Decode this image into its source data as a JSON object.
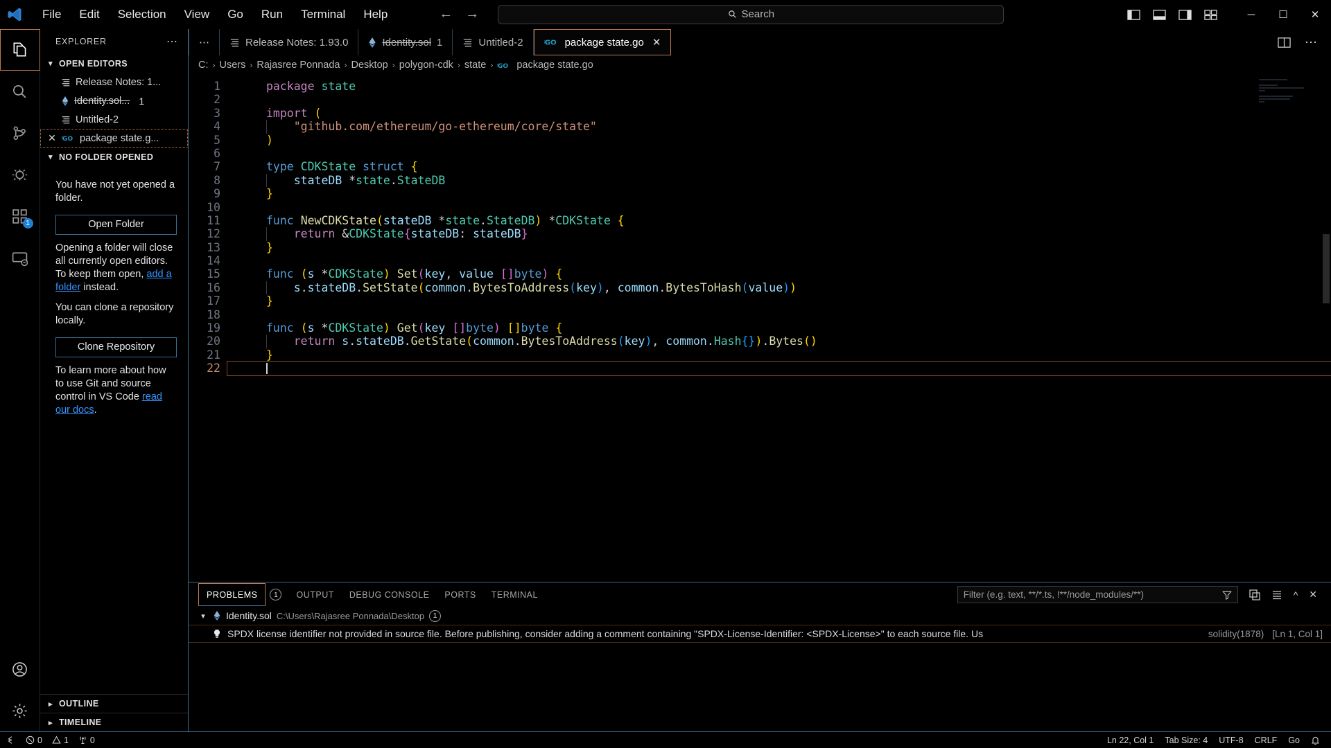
{
  "titlebar": {
    "logo_icon": "vscode-logo-icon",
    "menus": [
      "File",
      "Edit",
      "Selection",
      "View",
      "Go",
      "Run",
      "Terminal",
      "Help"
    ],
    "back_icon": "arrow-left-icon",
    "forward_icon": "arrow-right-icon",
    "search_placeholder": "Search",
    "search_icon": "search-icon",
    "layout_icons": [
      "toggle-primary-sidebar-icon",
      "toggle-panel-icon",
      "toggle-secondary-sidebar-icon",
      "customize-layout-icon"
    ],
    "window_controls": {
      "minimize": "─",
      "maximize": "☐",
      "close": "✕"
    }
  },
  "activitybar": {
    "items": [
      {
        "name": "explorer",
        "icon": "files-icon",
        "active": true,
        "badge": ""
      },
      {
        "name": "search",
        "icon": "search-icon",
        "active": false,
        "badge": ""
      },
      {
        "name": "source-control",
        "icon": "source-control-icon",
        "active": false,
        "badge": ""
      },
      {
        "name": "run-and-debug",
        "icon": "debug-icon",
        "active": false,
        "badge": ""
      },
      {
        "name": "extensions",
        "icon": "extensions-icon",
        "active": false,
        "badge": "1"
      },
      {
        "name": "remote-explorer",
        "icon": "remote-icon",
        "active": false,
        "badge": ""
      }
    ],
    "bottom": [
      {
        "name": "accounts",
        "icon": "account-icon"
      },
      {
        "name": "manage",
        "icon": "gear-icon"
      }
    ]
  },
  "sidebar": {
    "title": "EXPLORER",
    "more_actions": "⋯",
    "open_editors": {
      "label": "OPEN EDITORS",
      "items": [
        {
          "label": "Release Notes: 1...",
          "icon": "release-notes-icon",
          "badge": "",
          "selected": false,
          "strike": false
        },
        {
          "label": "Identity.sol...",
          "icon": "solidity-icon",
          "badge": "1",
          "selected": false,
          "strike": true
        },
        {
          "label": "Untitled-2",
          "icon": "file-lines-icon",
          "badge": "",
          "selected": false,
          "strike": false
        },
        {
          "label": "package state.g...",
          "icon": "go-icon",
          "badge": "",
          "selected": true,
          "strike": false,
          "close_icon": "close-icon"
        }
      ]
    },
    "no_folder": {
      "label": "NO FOLDER OPENED",
      "text1": "You have not yet opened a folder.",
      "open_folder_button": "Open Folder",
      "text2_a": "Opening a folder will close all currently open editors. To keep them open, ",
      "text2_link": "add a folder",
      "text2_b": " instead.",
      "text3": "You can clone a repository locally.",
      "clone_button": "Clone Repository",
      "text4_a": "To learn more about how to use Git and source control in VS Code ",
      "text4_link": "read our docs",
      "text4_b": "."
    },
    "outline": "OUTLINE",
    "timeline": "TIMELINE"
  },
  "tabs": {
    "more_icon": "⋯",
    "items": [
      {
        "label": "Release Notes: 1.93.0",
        "icon": "file-lines-icon",
        "active": false,
        "strike": false,
        "badge": ""
      },
      {
        "label": "Identity.sol",
        "icon": "solidity-icon",
        "active": false,
        "strike": true,
        "badge": "1"
      },
      {
        "label": "Untitled-2",
        "icon": "file-lines-icon",
        "active": false,
        "strike": false,
        "badge": ""
      },
      {
        "label": "package state.go",
        "icon": "go-icon",
        "active": true,
        "strike": false,
        "badge": "",
        "close_icon": "close-icon"
      }
    ],
    "right_actions": [
      "split-editor-icon",
      "more-actions-icon"
    ]
  },
  "breadcrumb": {
    "separator": "›",
    "items": [
      "C:",
      "Users",
      "Rajasree Ponnada",
      "Desktop",
      "polygon-cdk",
      "state",
      "package state.go"
    ],
    "last_icon": "go-icon"
  },
  "editor": {
    "language": "Go",
    "current_line": 22,
    "lines": [
      {
        "n": 1,
        "tokens": [
          {
            "t": "package",
            "c": "k-kw"
          },
          {
            "t": " ",
            "c": "k-plain"
          },
          {
            "t": "state",
            "c": "k-type"
          }
        ]
      },
      {
        "n": 2,
        "tokens": []
      },
      {
        "n": 3,
        "tokens": [
          {
            "t": "import",
            "c": "k-kw"
          },
          {
            "t": " ",
            "c": "k-plain"
          },
          {
            "t": "(",
            "c": "k-par"
          }
        ]
      },
      {
        "n": 4,
        "tokens": [
          {
            "t": "    ",
            "c": "k-plain"
          },
          {
            "t": "\"github.com/ethereum/go-ethereum/core/state\"",
            "c": "k-str"
          }
        ],
        "indent": true
      },
      {
        "n": 5,
        "tokens": [
          {
            "t": ")",
            "c": "k-par"
          }
        ]
      },
      {
        "n": 6,
        "tokens": []
      },
      {
        "n": 7,
        "tokens": [
          {
            "t": "type",
            "c": "k-kw2"
          },
          {
            "t": " ",
            "c": "k-plain"
          },
          {
            "t": "CDKState",
            "c": "k-type"
          },
          {
            "t": " ",
            "c": "k-plain"
          },
          {
            "t": "struct",
            "c": "k-kw2"
          },
          {
            "t": " ",
            "c": "k-plain"
          },
          {
            "t": "{",
            "c": "k-par"
          }
        ]
      },
      {
        "n": 8,
        "tokens": [
          {
            "t": "    ",
            "c": "k-plain"
          },
          {
            "t": "stateDB",
            "c": "k-var"
          },
          {
            "t": " *",
            "c": "k-plain"
          },
          {
            "t": "state",
            "c": "k-type"
          },
          {
            "t": ".",
            "c": "k-plain"
          },
          {
            "t": "StateDB",
            "c": "k-type"
          }
        ],
        "indent": true
      },
      {
        "n": 9,
        "tokens": [
          {
            "t": "}",
            "c": "k-par"
          }
        ]
      },
      {
        "n": 10,
        "tokens": []
      },
      {
        "n": 11,
        "tokens": [
          {
            "t": "func",
            "c": "k-kw2"
          },
          {
            "t": " ",
            "c": "k-plain"
          },
          {
            "t": "NewCDKState",
            "c": "k-fn"
          },
          {
            "t": "(",
            "c": "k-par"
          },
          {
            "t": "stateDB",
            "c": "k-var"
          },
          {
            "t": " *",
            "c": "k-plain"
          },
          {
            "t": "state",
            "c": "k-type"
          },
          {
            "t": ".",
            "c": "k-plain"
          },
          {
            "t": "StateDB",
            "c": "k-type"
          },
          {
            "t": ")",
            "c": "k-par"
          },
          {
            "t": " *",
            "c": "k-plain"
          },
          {
            "t": "CDKState",
            "c": "k-type"
          },
          {
            "t": " ",
            "c": "k-plain"
          },
          {
            "t": "{",
            "c": "k-par"
          }
        ]
      },
      {
        "n": 12,
        "tokens": [
          {
            "t": "    ",
            "c": "k-plain"
          },
          {
            "t": "return",
            "c": "k-kw"
          },
          {
            "t": " &",
            "c": "k-plain"
          },
          {
            "t": "CDKState",
            "c": "k-type"
          },
          {
            "t": "{",
            "c": "k-par2"
          },
          {
            "t": "stateDB",
            "c": "k-var"
          },
          {
            "t": ": ",
            "c": "k-plain"
          },
          {
            "t": "stateDB",
            "c": "k-var"
          },
          {
            "t": "}",
            "c": "k-par2"
          }
        ],
        "indent": true
      },
      {
        "n": 13,
        "tokens": [
          {
            "t": "}",
            "c": "k-par"
          }
        ]
      },
      {
        "n": 14,
        "tokens": []
      },
      {
        "n": 15,
        "tokens": [
          {
            "t": "func",
            "c": "k-kw2"
          },
          {
            "t": " ",
            "c": "k-plain"
          },
          {
            "t": "(",
            "c": "k-par"
          },
          {
            "t": "s",
            "c": "k-var"
          },
          {
            "t": " *",
            "c": "k-plain"
          },
          {
            "t": "CDKState",
            "c": "k-type"
          },
          {
            "t": ")",
            "c": "k-par"
          },
          {
            "t": " ",
            "c": "k-plain"
          },
          {
            "t": "Set",
            "c": "k-fn"
          },
          {
            "t": "(",
            "c": "k-par2"
          },
          {
            "t": "key",
            "c": "k-var"
          },
          {
            "t": ", ",
            "c": "k-plain"
          },
          {
            "t": "value",
            "c": "k-var"
          },
          {
            "t": " ",
            "c": "k-plain"
          },
          {
            "t": "[]",
            "c": "k-par2"
          },
          {
            "t": "byte",
            "c": "k-kw2"
          },
          {
            "t": ")",
            "c": "k-par2"
          },
          {
            "t": " ",
            "c": "k-plain"
          },
          {
            "t": "{",
            "c": "k-par"
          }
        ]
      },
      {
        "n": 16,
        "tokens": [
          {
            "t": "    ",
            "c": "k-plain"
          },
          {
            "t": "s",
            "c": "k-var"
          },
          {
            "t": ".",
            "c": "k-plain"
          },
          {
            "t": "stateDB",
            "c": "k-var"
          },
          {
            "t": ".",
            "c": "k-plain"
          },
          {
            "t": "SetState",
            "c": "k-fn"
          },
          {
            "t": "(",
            "c": "k-par"
          },
          {
            "t": "common",
            "c": "k-var"
          },
          {
            "t": ".",
            "c": "k-plain"
          },
          {
            "t": "BytesToAddress",
            "c": "k-fn"
          },
          {
            "t": "(",
            "c": "k-par3"
          },
          {
            "t": "key",
            "c": "k-var"
          },
          {
            "t": ")",
            "c": "k-par3"
          },
          {
            "t": ", ",
            "c": "k-plain"
          },
          {
            "t": "common",
            "c": "k-var"
          },
          {
            "t": ".",
            "c": "k-plain"
          },
          {
            "t": "BytesToHash",
            "c": "k-fn"
          },
          {
            "t": "(",
            "c": "k-par3"
          },
          {
            "t": "value",
            "c": "k-var"
          },
          {
            "t": ")",
            "c": "k-par3"
          },
          {
            "t": ")",
            "c": "k-par"
          }
        ],
        "indent": true
      },
      {
        "n": 17,
        "tokens": [
          {
            "t": "}",
            "c": "k-par"
          }
        ]
      },
      {
        "n": 18,
        "tokens": []
      },
      {
        "n": 19,
        "tokens": [
          {
            "t": "func",
            "c": "k-kw2"
          },
          {
            "t": " ",
            "c": "k-plain"
          },
          {
            "t": "(",
            "c": "k-par"
          },
          {
            "t": "s",
            "c": "k-var"
          },
          {
            "t": " *",
            "c": "k-plain"
          },
          {
            "t": "CDKState",
            "c": "k-type"
          },
          {
            "t": ")",
            "c": "k-par"
          },
          {
            "t": " ",
            "c": "k-plain"
          },
          {
            "t": "Get",
            "c": "k-fn"
          },
          {
            "t": "(",
            "c": "k-par2"
          },
          {
            "t": "key",
            "c": "k-var"
          },
          {
            "t": " ",
            "c": "k-plain"
          },
          {
            "t": "[]",
            "c": "k-par2"
          },
          {
            "t": "byte",
            "c": "k-kw2"
          },
          {
            "t": ")",
            "c": "k-par2"
          },
          {
            "t": " ",
            "c": "k-plain"
          },
          {
            "t": "[]",
            "c": "k-par"
          },
          {
            "t": "byte",
            "c": "k-kw2"
          },
          {
            "t": " ",
            "c": "k-plain"
          },
          {
            "t": "{",
            "c": "k-par"
          }
        ]
      },
      {
        "n": 20,
        "tokens": [
          {
            "t": "    ",
            "c": "k-plain"
          },
          {
            "t": "return",
            "c": "k-kw"
          },
          {
            "t": " ",
            "c": "k-plain"
          },
          {
            "t": "s",
            "c": "k-var"
          },
          {
            "t": ".",
            "c": "k-plain"
          },
          {
            "t": "stateDB",
            "c": "k-var"
          },
          {
            "t": ".",
            "c": "k-plain"
          },
          {
            "t": "GetState",
            "c": "k-fn"
          },
          {
            "t": "(",
            "c": "k-par"
          },
          {
            "t": "common",
            "c": "k-var"
          },
          {
            "t": ".",
            "c": "k-plain"
          },
          {
            "t": "BytesToAddress",
            "c": "k-fn"
          },
          {
            "t": "(",
            "c": "k-par3"
          },
          {
            "t": "key",
            "c": "k-var"
          },
          {
            "t": ")",
            "c": "k-par3"
          },
          {
            "t": ", ",
            "c": "k-plain"
          },
          {
            "t": "common",
            "c": "k-var"
          },
          {
            "t": ".",
            "c": "k-plain"
          },
          {
            "t": "Hash",
            "c": "k-type"
          },
          {
            "t": "{}",
            "c": "k-par3"
          },
          {
            "t": ")",
            "c": "k-par"
          },
          {
            "t": ".",
            "c": "k-plain"
          },
          {
            "t": "Bytes",
            "c": "k-fn"
          },
          {
            "t": "()",
            "c": "k-par"
          }
        ],
        "indent": true
      },
      {
        "n": 21,
        "tokens": [
          {
            "t": "}",
            "c": "k-par"
          }
        ]
      },
      {
        "n": 22,
        "tokens": [],
        "current": true
      }
    ]
  },
  "panel": {
    "tabs": [
      {
        "label": "PROBLEMS",
        "badge": "1",
        "active": true
      },
      {
        "label": "OUTPUT",
        "badge": "",
        "active": false
      },
      {
        "label": "DEBUG CONSOLE",
        "badge": "",
        "active": false
      },
      {
        "label": "PORTS",
        "badge": "",
        "active": false
      },
      {
        "label": "TERMINAL",
        "badge": "",
        "active": false
      }
    ],
    "filter_placeholder": "Filter (e.g. text, **/*.ts, !**/node_modules/**)",
    "filter_icon": "filter-icon",
    "actions": [
      "collapse-all-icon",
      "view-as-list-icon",
      "chevron-up-icon",
      "close-icon"
    ],
    "group": {
      "chevron": "chevron-down-icon",
      "file_icon": "solidity-icon",
      "file": "Identity.sol",
      "path": "C:\\Users\\Rajasree Ponnada\\Desktop",
      "count": "1"
    },
    "problem": {
      "icon": "lightbulb-icon",
      "message": "SPDX license identifier not provided in source file. Before publishing, consider adding a comment containing \"SPDX-License-Identifier: <SPDX-License>\" to each source file. Use \"SPDX-Lic…",
      "source": "solidity(1878)",
      "position": "[Ln 1, Col 1]"
    }
  },
  "statusbar": {
    "remote_icon": "remote-indicator-icon",
    "errors_icon": "error-icon",
    "errors": "0",
    "warnings_icon": "warning-icon",
    "warnings": "1",
    "ports_icon": "radio-tower-icon",
    "ports": "0",
    "right": [
      {
        "name": "cursor-position",
        "label": "Ln 22, Col 1"
      },
      {
        "name": "tab-size",
        "label": "Tab Size: 4"
      },
      {
        "name": "encoding",
        "label": "UTF-8"
      },
      {
        "name": "eol",
        "label": "CRLF"
      },
      {
        "name": "language-mode",
        "label": "Go"
      },
      {
        "name": "notifications",
        "label": "",
        "icon": "bell-icon"
      }
    ]
  },
  "colors": {
    "accent_border": "#c07a51",
    "panel_border": "#3b6e8f",
    "link": "#3794ff",
    "background": "#000000"
  }
}
